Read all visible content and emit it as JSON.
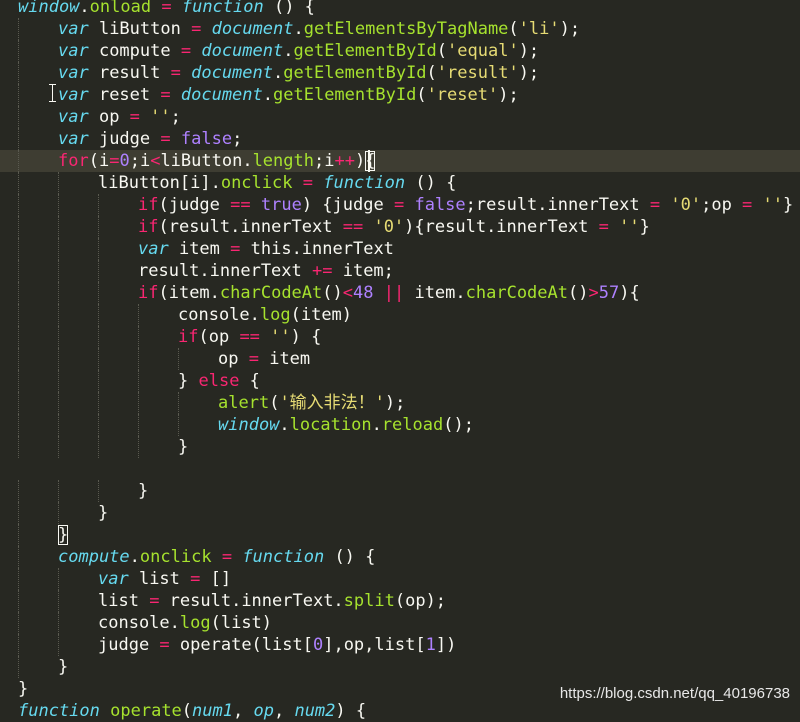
{
  "editor": {
    "current_line": 8,
    "lines": [
      {
        "indent": 0,
        "tokens": [
          [
            "st",
            "window"
          ],
          [
            "pl",
            "."
          ],
          [
            "pr",
            "onload"
          ],
          [
            "pl",
            " "
          ],
          [
            "op",
            "="
          ],
          [
            "pl",
            " "
          ],
          [
            "st",
            "function"
          ],
          [
            "pl",
            " () {"
          ]
        ]
      },
      {
        "indent": 1,
        "tokens": [
          [
            "st",
            "var"
          ],
          [
            "pl",
            " liButton "
          ],
          [
            "op",
            "="
          ],
          [
            "pl",
            " "
          ],
          [
            "it",
            "document"
          ],
          [
            "pl",
            "."
          ],
          [
            "pr",
            "getElementsByTagName"
          ],
          [
            "pl",
            "("
          ],
          [
            "str",
            "'li'"
          ],
          [
            "pl",
            ");"
          ]
        ]
      },
      {
        "indent": 1,
        "tokens": [
          [
            "st",
            "var"
          ],
          [
            "pl",
            " compute "
          ],
          [
            "op",
            "="
          ],
          [
            "pl",
            " "
          ],
          [
            "it",
            "document"
          ],
          [
            "pl",
            "."
          ],
          [
            "pr",
            "getElementById"
          ],
          [
            "pl",
            "("
          ],
          [
            "str",
            "'equal'"
          ],
          [
            "pl",
            ");"
          ]
        ]
      },
      {
        "indent": 1,
        "tokens": [
          [
            "st",
            "var"
          ],
          [
            "pl",
            " result "
          ],
          [
            "op",
            "="
          ],
          [
            "pl",
            " "
          ],
          [
            "it",
            "document"
          ],
          [
            "pl",
            "."
          ],
          [
            "pr",
            "getElementById"
          ],
          [
            "pl",
            "("
          ],
          [
            "str",
            "'result'"
          ],
          [
            "pl",
            ");"
          ]
        ]
      },
      {
        "indent": 1,
        "tokens": [
          [
            "st",
            "var"
          ],
          [
            "pl",
            " reset "
          ],
          [
            "op",
            "="
          ],
          [
            "pl",
            " "
          ],
          [
            "it",
            "document"
          ],
          [
            "pl",
            "."
          ],
          [
            "pr",
            "getElementById"
          ],
          [
            "pl",
            "("
          ],
          [
            "str",
            "'reset'"
          ],
          [
            "pl",
            ");"
          ]
        ]
      },
      {
        "indent": 1,
        "tokens": [
          [
            "st",
            "var"
          ],
          [
            "pl",
            " op "
          ],
          [
            "op",
            "="
          ],
          [
            "pl",
            " "
          ],
          [
            "str",
            "''"
          ],
          [
            "pl",
            ";"
          ]
        ]
      },
      {
        "indent": 1,
        "tokens": [
          [
            "st",
            "var"
          ],
          [
            "pl",
            " judge "
          ],
          [
            "op",
            "="
          ],
          [
            "pl",
            " "
          ],
          [
            "num",
            "false"
          ],
          [
            "pl",
            ";"
          ]
        ]
      },
      {
        "indent": 1,
        "tokens": [
          [
            "kw",
            "for"
          ],
          [
            "pl",
            "(i"
          ],
          [
            "op",
            "="
          ],
          [
            "num",
            "0"
          ],
          [
            "pl",
            ";i"
          ],
          [
            "op",
            "<"
          ],
          [
            "pl",
            "liButton."
          ],
          [
            "pr",
            "length"
          ],
          [
            "pl",
            ";i"
          ],
          [
            "op",
            "++"
          ],
          [
            "pl",
            ")"
          ],
          [
            "pl",
            "{"
          ]
        ]
      },
      {
        "indent": 2,
        "tokens": [
          [
            "pl",
            "liButton[i]."
          ],
          [
            "pr",
            "onclick"
          ],
          [
            "pl",
            " "
          ],
          [
            "op",
            "="
          ],
          [
            "pl",
            " "
          ],
          [
            "st",
            "function"
          ],
          [
            "pl",
            " () {"
          ]
        ]
      },
      {
        "indent": 3,
        "tokens": [
          [
            "kw",
            "if"
          ],
          [
            "pl",
            "(judge "
          ],
          [
            "op",
            "=="
          ],
          [
            "pl",
            " "
          ],
          [
            "num",
            "true"
          ],
          [
            "pl",
            ") {judge "
          ],
          [
            "op",
            "="
          ],
          [
            "pl",
            " "
          ],
          [
            "num",
            "false"
          ],
          [
            "pl",
            ";result.innerText "
          ],
          [
            "op",
            "="
          ],
          [
            "pl",
            " "
          ],
          [
            "str",
            "'0'"
          ],
          [
            "pl",
            ";op "
          ],
          [
            "op",
            "="
          ],
          [
            "pl",
            " "
          ],
          [
            "str",
            "''"
          ],
          [
            "pl",
            "}"
          ]
        ]
      },
      {
        "indent": 3,
        "tokens": [
          [
            "kw",
            "if"
          ],
          [
            "pl",
            "(result.innerText "
          ],
          [
            "op",
            "=="
          ],
          [
            "pl",
            " "
          ],
          [
            "str",
            "'0'"
          ],
          [
            "pl",
            ")"
          ],
          [
            "pl",
            "{result.innerText "
          ],
          [
            "op",
            "="
          ],
          [
            "pl",
            " "
          ],
          [
            "str",
            "''"
          ],
          [
            "pl",
            "}"
          ]
        ]
      },
      {
        "indent": 3,
        "tokens": [
          [
            "st",
            "var"
          ],
          [
            "pl",
            " item "
          ],
          [
            "op",
            "="
          ],
          [
            "pl",
            " this.innerText"
          ]
        ]
      },
      {
        "indent": 3,
        "tokens": [
          [
            "pl",
            "result.innerText "
          ],
          [
            "op",
            "+="
          ],
          [
            "pl",
            " item;"
          ]
        ]
      },
      {
        "indent": 3,
        "tokens": [
          [
            "kw",
            "if"
          ],
          [
            "pl",
            "(item."
          ],
          [
            "pr",
            "charCodeAt"
          ],
          [
            "pl",
            "()"
          ],
          [
            "op",
            "<"
          ],
          [
            "num",
            "48"
          ],
          [
            "pl",
            " "
          ],
          [
            "op",
            "||"
          ],
          [
            "pl",
            " item."
          ],
          [
            "pr",
            "charCodeAt"
          ],
          [
            "pl",
            "()"
          ],
          [
            "op",
            ">"
          ],
          [
            "num",
            "57"
          ],
          [
            "pl",
            "){"
          ]
        ]
      },
      {
        "indent": 4,
        "tokens": [
          [
            "pl",
            "console."
          ],
          [
            "pr",
            "log"
          ],
          [
            "pl",
            "(item)"
          ]
        ]
      },
      {
        "indent": 4,
        "tokens": [
          [
            "kw",
            "if"
          ],
          [
            "pl",
            "(op "
          ],
          [
            "op",
            "=="
          ],
          [
            "pl",
            " "
          ],
          [
            "str",
            "''"
          ],
          [
            "pl",
            ") {"
          ]
        ]
      },
      {
        "indent": 5,
        "tokens": [
          [
            "pl",
            "op "
          ],
          [
            "op",
            "="
          ],
          [
            "pl",
            " item"
          ]
        ]
      },
      {
        "indent": 4,
        "tokens": [
          [
            "pl",
            "} "
          ],
          [
            "kw",
            "else"
          ],
          [
            "pl",
            " {"
          ]
        ]
      },
      {
        "indent": 5,
        "tokens": [
          [
            "pr",
            "alert"
          ],
          [
            "pl",
            "("
          ],
          [
            "str",
            "'输入非法！'"
          ],
          [
            "pl",
            ");"
          ]
        ]
      },
      {
        "indent": 5,
        "tokens": [
          [
            "st",
            "window"
          ],
          [
            "pl",
            "."
          ],
          [
            "pr",
            "location"
          ],
          [
            "pl",
            "."
          ],
          [
            "pr",
            "reload"
          ],
          [
            "pl",
            "();"
          ]
        ]
      },
      {
        "indent": 4,
        "tokens": [
          [
            "pl",
            "}"
          ]
        ]
      },
      {
        "indent": 0,
        "tokens": []
      },
      {
        "indent": 3,
        "tokens": [
          [
            "pl",
            "}"
          ]
        ]
      },
      {
        "indent": 2,
        "tokens": [
          [
            "pl",
            "}"
          ]
        ]
      },
      {
        "indent": 1,
        "tokens": [
          [
            "pl",
            "}"
          ]
        ]
      },
      {
        "indent": 1,
        "tokens": [
          [
            "st",
            "compute"
          ],
          [
            "pl",
            "."
          ],
          [
            "pr",
            "onclick"
          ],
          [
            "pl",
            " "
          ],
          [
            "op",
            "="
          ],
          [
            "pl",
            " "
          ],
          [
            "st",
            "function"
          ],
          [
            "pl",
            " () {"
          ]
        ]
      },
      {
        "indent": 2,
        "tokens": [
          [
            "st",
            "var"
          ],
          [
            "pl",
            " list "
          ],
          [
            "op",
            "="
          ],
          [
            "pl",
            " []"
          ]
        ]
      },
      {
        "indent": 2,
        "tokens": [
          [
            "pl",
            "list "
          ],
          [
            "op",
            "="
          ],
          [
            "pl",
            " result.innerText."
          ],
          [
            "pr",
            "split"
          ],
          [
            "pl",
            "(op);"
          ]
        ]
      },
      {
        "indent": 2,
        "tokens": [
          [
            "pl",
            "console."
          ],
          [
            "pr",
            "log"
          ],
          [
            "pl",
            "(list)"
          ]
        ]
      },
      {
        "indent": 2,
        "tokens": [
          [
            "pl",
            "judge "
          ],
          [
            "op",
            "="
          ],
          [
            "pl",
            " operate(list["
          ],
          [
            "num",
            "0"
          ],
          [
            "pl",
            "],op,list["
          ],
          [
            "num",
            "1"
          ],
          [
            "pl",
            "])"
          ]
        ]
      },
      {
        "indent": 1,
        "tokens": [
          [
            "pl",
            "}"
          ]
        ]
      },
      {
        "indent": 0,
        "tokens": [
          [
            "pl",
            "}"
          ]
        ]
      },
      {
        "indent": 0,
        "tokens": [
          [
            "st",
            "function"
          ],
          [
            "pl",
            " "
          ],
          [
            "pr",
            "operate"
          ],
          [
            "pl",
            "("
          ],
          [
            "it",
            "num1"
          ],
          [
            "pl",
            ", "
          ],
          [
            "it",
            "op"
          ],
          [
            "pl",
            ", "
          ],
          [
            "it",
            "num2"
          ],
          [
            "pl",
            ") {"
          ]
        ]
      }
    ]
  },
  "watermark": {
    "text": "https://blog.csdn.net/qq_40196738"
  }
}
